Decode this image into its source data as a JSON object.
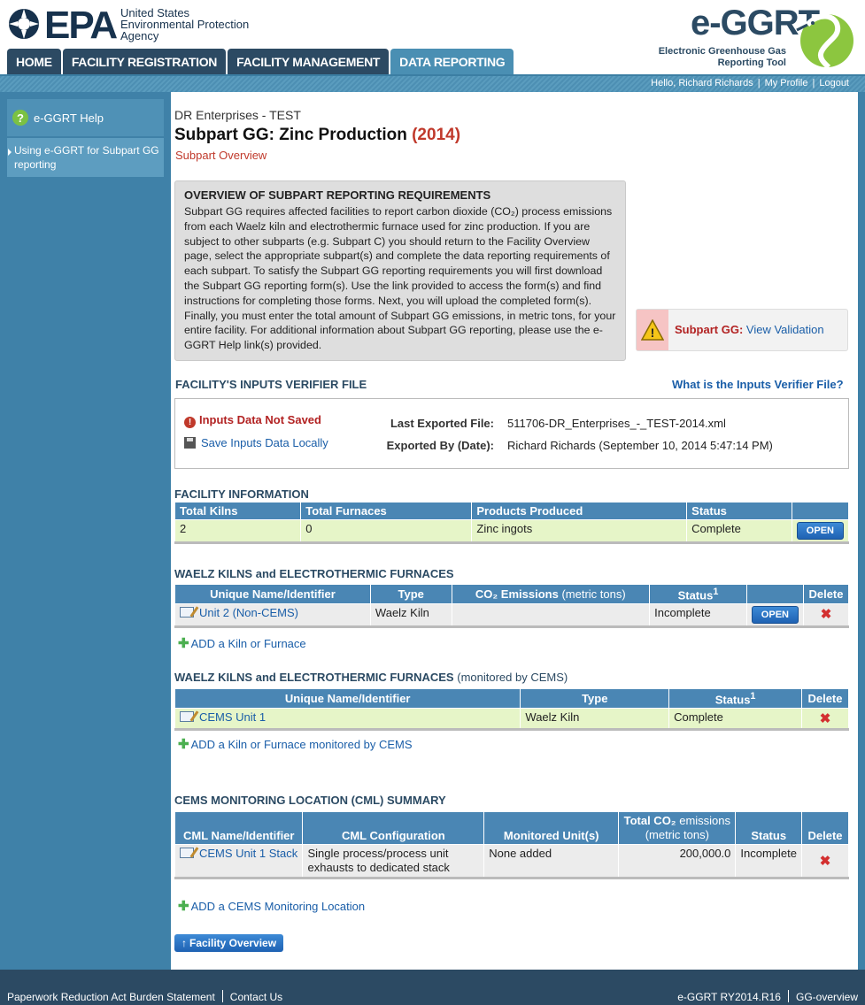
{
  "header": {
    "epa_word": "EPA",
    "agency_line1": "United States",
    "agency_line2": "Environmental Protection",
    "agency_line3": "Agency",
    "app_name": "e-GGRT",
    "app_sub_line1": "Electronic Greenhouse Gas",
    "app_sub_line2": "Reporting Tool"
  },
  "nav": [
    {
      "label": "HOME"
    },
    {
      "label": "FACILITY REGISTRATION"
    },
    {
      "label": "FACILITY MANAGEMENT"
    },
    {
      "label": "DATA REPORTING"
    }
  ],
  "user_bar": {
    "greeting": "Hello, Richard Richards",
    "profile": "My Profile",
    "logout": "Logout",
    "sep": "|"
  },
  "sidebar": {
    "help_icon_char": "?",
    "help_label": "e-GGRT Help",
    "help_link": "Using e-GGRT for Subpart GG reporting"
  },
  "page": {
    "facility_name": "DR Enterprises - TEST",
    "title": "Subpart GG: Zinc Production",
    "year": "(2014)",
    "subtitle": "Subpart Overview"
  },
  "overview": {
    "title": "OVERVIEW OF SUBPART REPORTING REQUIREMENTS",
    "body": "Subpart GG requires affected facilities to report carbon dioxide (CO₂) process emissions from each Waelz kiln and electrothermic furnace used for zinc production. If you are subject to other subparts (e.g. Subpart C) you should return to the Facility Overview page, select the appropriate subpart(s) and complete the data reporting requirements of each subpart. To satisfy the Subpart GG reporting requirements you will first download the Subpart GG reporting form(s). Use the link provided to access the form(s) and find instructions for completing those forms. Next, you will upload the completed form(s). Finally, you must enter the total amount of Subpart GG emissions, in metric tons, for your entire facility. For additional information about Subpart GG reporting, please use the e-GGRT Help link(s) provided."
  },
  "validation": {
    "icon_char": "!",
    "label": "Subpart GG:",
    "link": "View Validation"
  },
  "verifier": {
    "title": "FACILITY'S INPUTS VERIFIER FILE",
    "help_link": "What is the Inputs Verifier File?",
    "status_icon_char": "!",
    "status": "Inputs Data Not Saved",
    "save_link": "Save Inputs Data Locally",
    "last_exported_label": "Last Exported File:",
    "last_exported_value": "511706-DR_Enterprises_-_TEST-2014.xml",
    "exported_by_label": "Exported By (Date):",
    "exported_by_value": "Richard Richards (September 10, 2014 5:47:14 PM)"
  },
  "facility_info": {
    "title": "FACILITY INFORMATION",
    "headers": [
      "Total Kilns",
      "Total Furnaces",
      "Products Produced",
      "Status",
      ""
    ],
    "row": {
      "kilns": "2",
      "furnaces": "0",
      "products": "Zinc ingots",
      "status": "Complete",
      "button": "OPEN"
    }
  },
  "kilns": {
    "title": "WAELZ KILNS and ELECTROTHERMIC FURNACES",
    "headers": {
      "name": "Unique Name/Identifier",
      "type": "Type",
      "co2": "CO₂ Emissions",
      "co2_unit": "(metric tons)",
      "status": "Status",
      "status_sup": "1",
      "delete": "Delete"
    },
    "row": {
      "name": "Unit 2 (Non-CEMS)",
      "type": "Waelz Kiln",
      "co2": "",
      "status": "Incomplete",
      "button": "OPEN",
      "delete": "✖"
    },
    "add_link": "ADD a Kiln or Furnace"
  },
  "kilns_cems": {
    "title": "WAELZ KILNS and ELECTROTHERMIC FURNACES",
    "title_suffix": "(monitored by CEMS)",
    "headers": {
      "name": "Unique Name/Identifier",
      "type": "Type",
      "status": "Status",
      "status_sup": "1",
      "delete": "Delete"
    },
    "row": {
      "name": "CEMS Unit 1",
      "type": "Waelz Kiln",
      "status": "Complete",
      "delete": "✖"
    },
    "add_link": "ADD a Kiln or Furnace monitored by CEMS"
  },
  "cml": {
    "title": "CEMS MONITORING LOCATION (CML) SUMMARY",
    "headers": {
      "name": "CML Name/Identifier",
      "config": "CML Configuration",
      "units": "Monitored Unit(s)",
      "total": "Total CO₂",
      "total_unit": "emissions (metric tons)",
      "status": "Status",
      "delete": "Delete"
    },
    "row": {
      "name": "CEMS Unit 1 Stack",
      "config": "Single process/process unit exhausts to dedicated stack",
      "units": "None added",
      "total": "200,000.0",
      "status": "Incomplete",
      "delete": "✖"
    },
    "add_link": "ADD a CEMS Monitoring Location"
  },
  "facility_overview_button": "Facility Overview",
  "footer": {
    "burden": "Paperwork Reduction Act Burden Statement",
    "contact": "Contact Us",
    "version": "e-GGRT RY2014.R16",
    "page_id": "GG-overview"
  },
  "colors": {
    "navy": "#2c4a63",
    "sidebar_blue": "#3f81a8",
    "header_blue": "#4a86b4",
    "alert_red": "#c0392b",
    "complete_green": "#e6f5c8"
  }
}
